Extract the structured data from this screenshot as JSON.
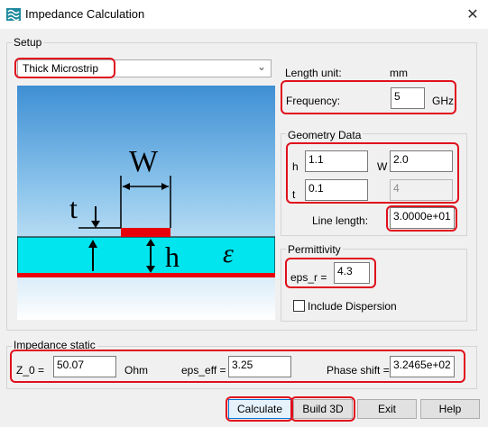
{
  "window": {
    "title": "Impedance Calculation"
  },
  "setup": {
    "group_label": "Setup",
    "structure_type": "Thick Microstrip",
    "length_unit_label": "Length unit:",
    "length_unit_value": "mm",
    "frequency_label": "Frequency:",
    "frequency_value": "5",
    "frequency_unit": "GHz"
  },
  "diagram": {
    "w": "W",
    "t": "t",
    "h": "h",
    "eps": "ε"
  },
  "geometry": {
    "group_label": "Geometry Data",
    "h_label": "h",
    "h_value": "1.1",
    "w_label": "W",
    "w_value": "2.0",
    "t_label": "t",
    "t_value": "0.1",
    "extra_value": "4",
    "line_length_label": "Line length:",
    "line_length_value": "3.0000e+01"
  },
  "permittivity": {
    "group_label": "Permittivity",
    "eps_label": "eps_r =",
    "eps_value": "4.3",
    "dispersion_label": "Include Dispersion",
    "dispersion_checked": false
  },
  "impedance": {
    "group_label": "Impedance static",
    "z0_label": "Z_0 =",
    "z0_value": "50.07",
    "z0_unit": "Ohm",
    "eps_eff_label": "eps_eff =",
    "eps_eff_value": "3.25",
    "phase_label": "Phase shift =",
    "phase_value": "3.2465e+02"
  },
  "buttons": {
    "calculate": "Calculate",
    "build3d": "Build 3D",
    "exit": "Exit",
    "help": "Help"
  },
  "colors": {
    "highlight": "#e0101c",
    "substrate": "#00e5ee",
    "trace": "#e8000a",
    "ground": "#e8000a"
  }
}
